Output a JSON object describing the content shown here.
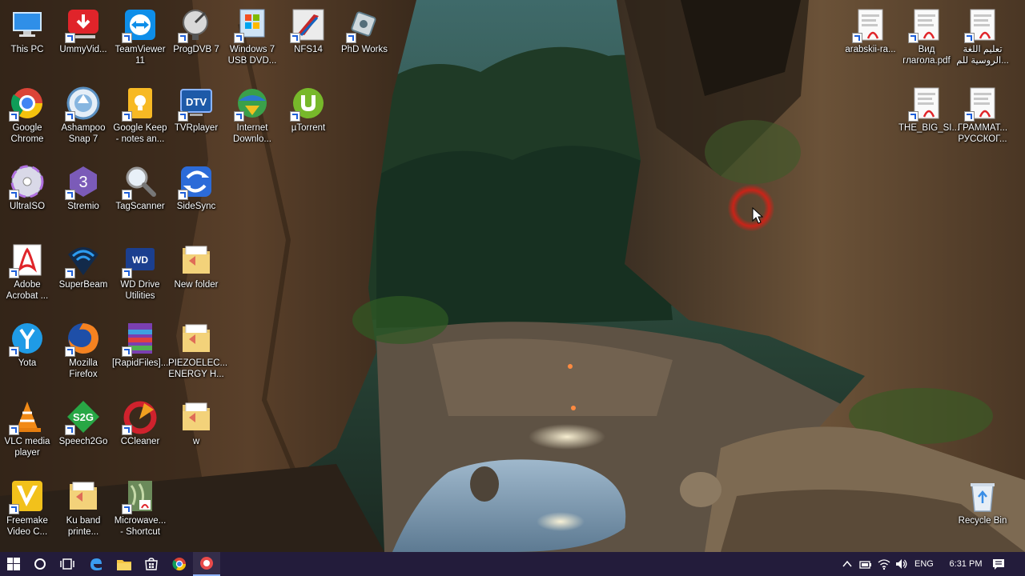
{
  "desktop_icons": [
    {
      "label": "This PC",
      "icon": "this-pc-icon"
    },
    {
      "label": "UmmyVid...",
      "icon": "ummy-video-downloader-icon"
    },
    {
      "label": "TeamViewer\n11",
      "icon": "teamviewer-icon"
    },
    {
      "label": "ProgDVB 7",
      "icon": "progdvb-satellite-icon"
    },
    {
      "label": "Windows 7\nUSB DVD...",
      "icon": "windows-usb-dvd-tool-icon"
    },
    {
      "label": "NFS14",
      "icon": "nfs14-game-icon"
    },
    {
      "label": "PhD Works",
      "icon": "phd-works-icon"
    },
    {
      "label": "Google\nChrome",
      "icon": "chrome-icon"
    },
    {
      "label": "Ashampoo\nSnap 7",
      "icon": "ashampoo-snap-icon"
    },
    {
      "label": "Google Keep\n- notes an...",
      "icon": "google-keep-icon"
    },
    {
      "label": "TVRplayer",
      "icon": "tvrplayer-icon"
    },
    {
      "label": "Internet\nDownlo...",
      "icon": "internet-download-manager-icon"
    },
    {
      "label": "µTorrent",
      "icon": "utorrent-icon"
    },
    {
      "label": "UltraISO",
      "icon": "ultraiso-disc-icon"
    },
    {
      "label": "Stremio",
      "icon": "stremio-icon"
    },
    {
      "label": "TagScanner",
      "icon": "tagscanner-magnifier-icon"
    },
    {
      "label": "SideSync",
      "icon": "sidesync-icon"
    },
    {
      "label": "Adobe\nAcrobat ...",
      "icon": "adobe-acrobat-icon"
    },
    {
      "label": "SuperBeam",
      "icon": "superbeam-wifi-icon"
    },
    {
      "label": "WD Drive\nUtilities",
      "icon": "wd-drive-utilities-icon"
    },
    {
      "label": "New folder",
      "icon": "folder-icon"
    },
    {
      "label": "Yota",
      "icon": "yota-icon"
    },
    {
      "label": "Mozilla\nFirefox",
      "icon": "firefox-icon"
    },
    {
      "label": "[RapidFiles]...",
      "icon": "winrar-archive-icon"
    },
    {
      "label": "PIEZOELEC...\nENERGY H...",
      "icon": "folder-icon"
    },
    {
      "label": "VLC media\nplayer",
      "icon": "vlc-cone-icon"
    },
    {
      "label": "Speech2Go",
      "icon": "speech2go-icon"
    },
    {
      "label": "CCleaner",
      "icon": "ccleaner-icon"
    },
    {
      "label": "w",
      "icon": "folder-icon"
    },
    {
      "label": "Freemake\nVideo C...",
      "icon": "freemake-video-converter-icon"
    },
    {
      "label": "Ku band\nprinte...",
      "icon": "folder-icon"
    },
    {
      "label": "Microwave...\n- Shortcut",
      "icon": "pdf-shortcut-icon"
    },
    {
      "label": "arabskii-ra...",
      "icon": "pdf-document-icon"
    },
    {
      "label": "Вид\nглагола.pdf",
      "icon": "pdf-document-icon"
    },
    {
      "label": "تعليم اللغة\nالروسية للم...",
      "icon": "pdf-document-icon"
    },
    {
      "label": "THE_BIG_SI...",
      "icon": "pdf-document-icon"
    },
    {
      "label": "ГРАММАТ...\nРУССКОГ...",
      "icon": "pdf-document-icon"
    },
    {
      "label": "Recycle Bin",
      "icon": "recycle-bin-icon"
    }
  ],
  "taskbar": {
    "pinned": [
      "start-windows-icon",
      "cortana-search-icon",
      "task-view-icon",
      "edge-icon",
      "file-explorer-icon",
      "store-icon",
      "chrome-icon",
      "ashampoo-snap-icon"
    ],
    "tray": {
      "language": "ENG",
      "time": "6:31 PM"
    }
  },
  "colors": {
    "taskbar_bg": "#231c3b",
    "label_text": "#ffffff"
  }
}
